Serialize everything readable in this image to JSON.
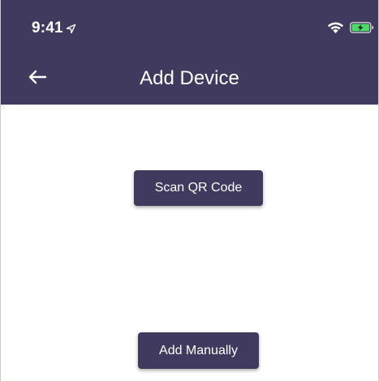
{
  "status_bar": {
    "time": "9:41",
    "icons": [
      "location-arrow-icon",
      "wifi-icon",
      "battery-charging-icon"
    ],
    "battery_color": "#4cd964"
  },
  "header": {
    "title": "Add Device",
    "back_icon": "arrow-left-icon",
    "background_color": "#3f3a5e"
  },
  "actions": {
    "scan_label": "Scan QR Code",
    "manual_label": "Add Manually",
    "button_color": "#3f3a5e"
  }
}
